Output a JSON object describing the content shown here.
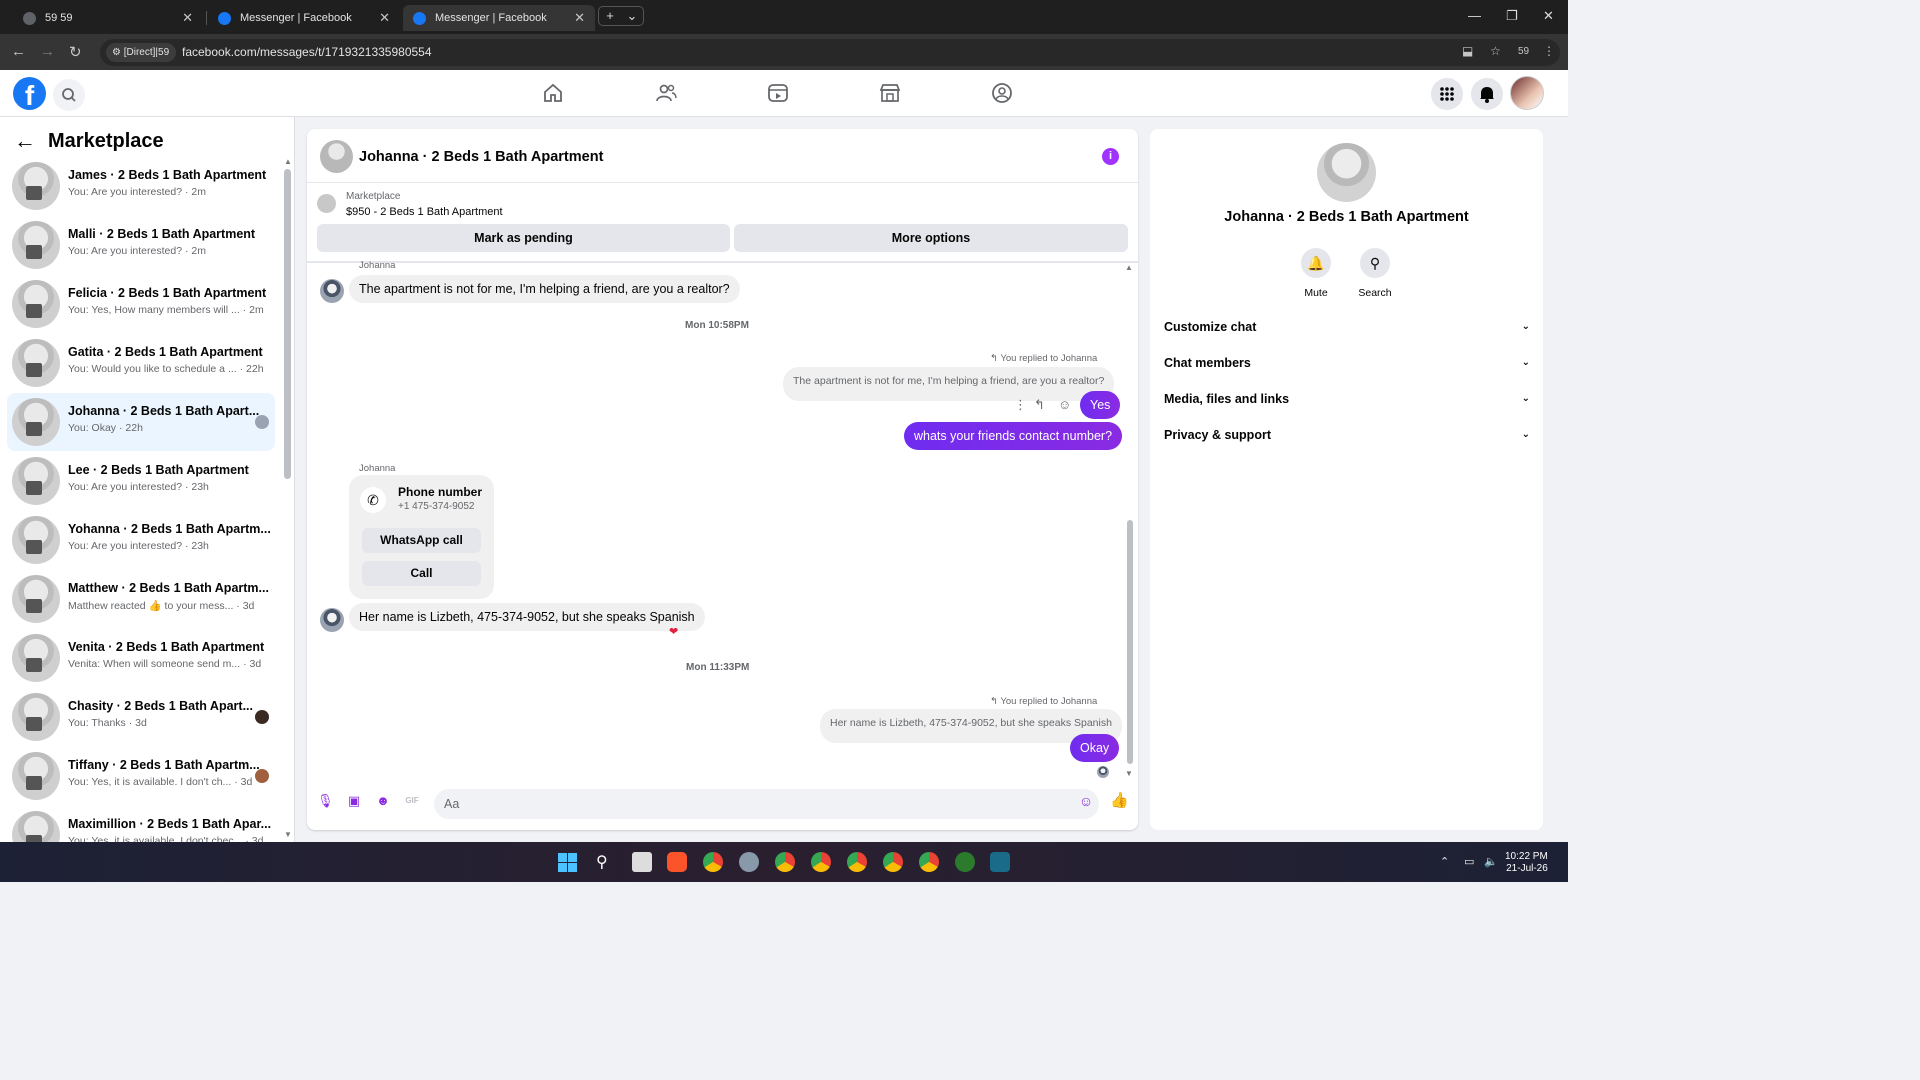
{
  "browser": {
    "tabs": [
      {
        "title": "59 59"
      },
      {
        "title": "Messenger | Facebook"
      },
      {
        "title": "Messenger | Facebook"
      }
    ],
    "site_chip": "[Direct]|59",
    "url": "facebook.com/messages/t/1719321335980554",
    "profile_badge": "59"
  },
  "left": {
    "title": "Marketplace",
    "conversations": [
      {
        "name": "James · 2 Beds 1 Bath Apartment",
        "preview": "You: Are you interested? · 2m"
      },
      {
        "name": "Malli · 2 Beds 1 Bath Apartment",
        "preview": "You: Are you interested? · 2m"
      },
      {
        "name": "Felicia · 2 Beds 1 Bath Apartment",
        "preview": "You: Yes, How many members will ... · 2m"
      },
      {
        "name": "Gatita · 2 Beds 1 Bath Apartment",
        "preview": "You: Would you like to schedule a ... · 22h"
      },
      {
        "name": "Johanna · 2 Beds 1 Bath Apart...",
        "preview": "You: Okay · 22h"
      },
      {
        "name": "Lee · 2 Beds 1 Bath Apartment",
        "preview": "You: Are you interested? · 23h"
      },
      {
        "name": "Yohanna · 2 Beds 1 Bath Apartm...",
        "preview": "You: Are you interested? · 23h"
      },
      {
        "name": "Matthew · 2 Beds 1 Bath Apartm...",
        "preview": "Matthew reacted 👍 to your mess... · 3d"
      },
      {
        "name": "Venita · 2 Beds 1 Bath Apartment",
        "preview": "Venita: When will someone send m... · 3d"
      },
      {
        "name": "Chasity · 2 Beds 1 Bath Apart...",
        "preview": "You: Thanks · 3d"
      },
      {
        "name": "Tiffany · 2 Beds 1 Bath Apartm...",
        "preview": "You: Yes, it is available. I don't ch... · 3d"
      },
      {
        "name": "Maximillion · 2 Beds 1 Bath Apar...",
        "preview": "You: Yes, it is available. I don't chec... · 3d"
      }
    ]
  },
  "chat": {
    "title": "Johanna · 2 Beds 1 Bath Apartment",
    "marketplace_label": "Marketplace",
    "listing": "$950 - 2 Beds 1 Bath Apartment",
    "btn_pending": "Mark as pending",
    "btn_more": "More options",
    "sender_name": "Johanna",
    "msg1": "The apartment is not for me, I'm helping a friend, are you a realtor?",
    "time1": "Mon 10:58PM",
    "replied_label": "You replied to Johanna",
    "quoted1": "The apartment is not for me, I'm helping a friend, are you a realtor?",
    "out_yes": "Yes",
    "out_contact": "whats your friends contact number?",
    "phone_title": "Phone number",
    "phone_number": "+1 475-374-9052",
    "btn_whatsapp": "WhatsApp call",
    "btn_call": "Call",
    "msg2": "Her name is Lizbeth, 475-374-9052, but she speaks Spanish",
    "time2": "Mon 11:33PM",
    "quoted2": "Her name is Lizbeth, 475-374-9052, but she speaks Spanish",
    "out_okay": "Okay",
    "input_placeholder": "Aa"
  },
  "right": {
    "title": "Johanna · 2 Beds 1 Bath Apartment",
    "mute": "Mute",
    "search": "Search",
    "sections": [
      "Customize chat",
      "Chat members",
      "Media, files and links",
      "Privacy & support"
    ]
  },
  "taskbar": {
    "time": "10:22 PM",
    "date": "21-Jul-26"
  },
  "colors": {
    "brand": "#1877f2",
    "outgoing_bubble": "#7a25f5",
    "active_conv": "#ebf5ff"
  }
}
